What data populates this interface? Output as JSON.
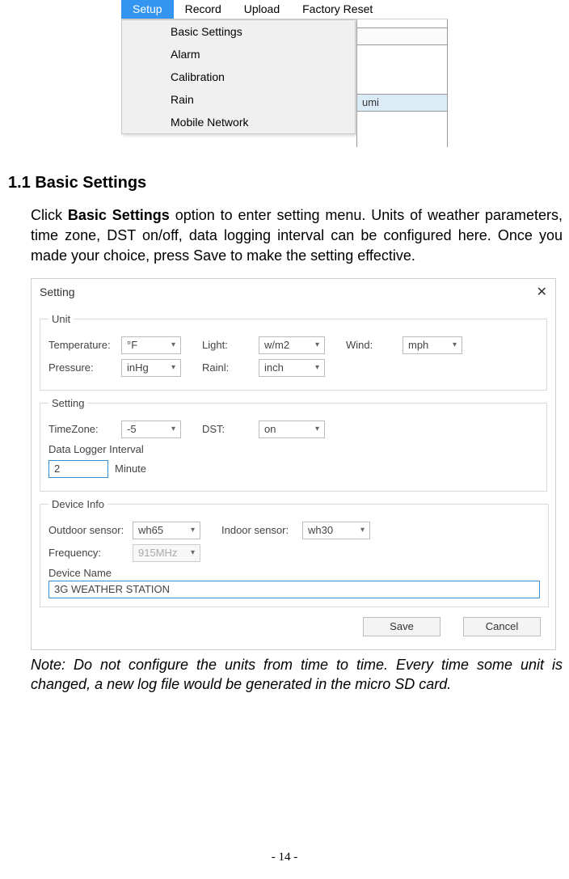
{
  "menu": {
    "items": [
      "Setup",
      "Record",
      "Upload",
      "Factory Reset"
    ],
    "active": "Setup",
    "dropdown": [
      "Basic Settings",
      "Alarm",
      "Calibration",
      "Rain",
      "Mobile Network"
    ],
    "partial_text": "umi"
  },
  "doc": {
    "heading": "1.1 Basic Settings",
    "para_pre": "Click ",
    "para_bold": "Basic Settings",
    "para_post": " option to enter setting menu. Units of weather parameters, time zone, DST on/off, data logging interval can be configured here. Once you made your choice, press Save to make the setting effective.",
    "note": "Note: Do not configure the units from time to time. Every time some unit is changed, a new log file would be generated in the micro SD card.",
    "page": "- 14 -"
  },
  "dialog": {
    "title": "Setting",
    "groups": {
      "unit": {
        "legend": "Unit",
        "temperature_label": "Temperature:",
        "temperature_value": "°F",
        "light_label": "Light:",
        "light_value": "w/m2",
        "wind_label": "Wind:",
        "wind_value": "mph",
        "pressure_label": "Pressure:",
        "pressure_value": "inHg",
        "rain_label": "Rainl:",
        "rain_value": "inch"
      },
      "setting": {
        "legend": "Setting",
        "timezone_label": "TimeZone:",
        "timezone_value": "-5",
        "dst_label": "DST:",
        "dst_value": "on",
        "interval_legend": "Data Logger Interval",
        "interval_value": "2",
        "interval_unit": "Minute"
      },
      "device": {
        "legend": "Device Info",
        "outdoor_label": "Outdoor sensor:",
        "outdoor_value": "wh65",
        "indoor_label": "Indoor sensor:",
        "indoor_value": "wh30",
        "frequency_label": "Frequency:",
        "frequency_value": "915MHz",
        "name_label": "Device Name",
        "name_value": "3G WEATHER STATION"
      }
    },
    "buttons": {
      "save": "Save",
      "cancel": "Cancel"
    }
  }
}
